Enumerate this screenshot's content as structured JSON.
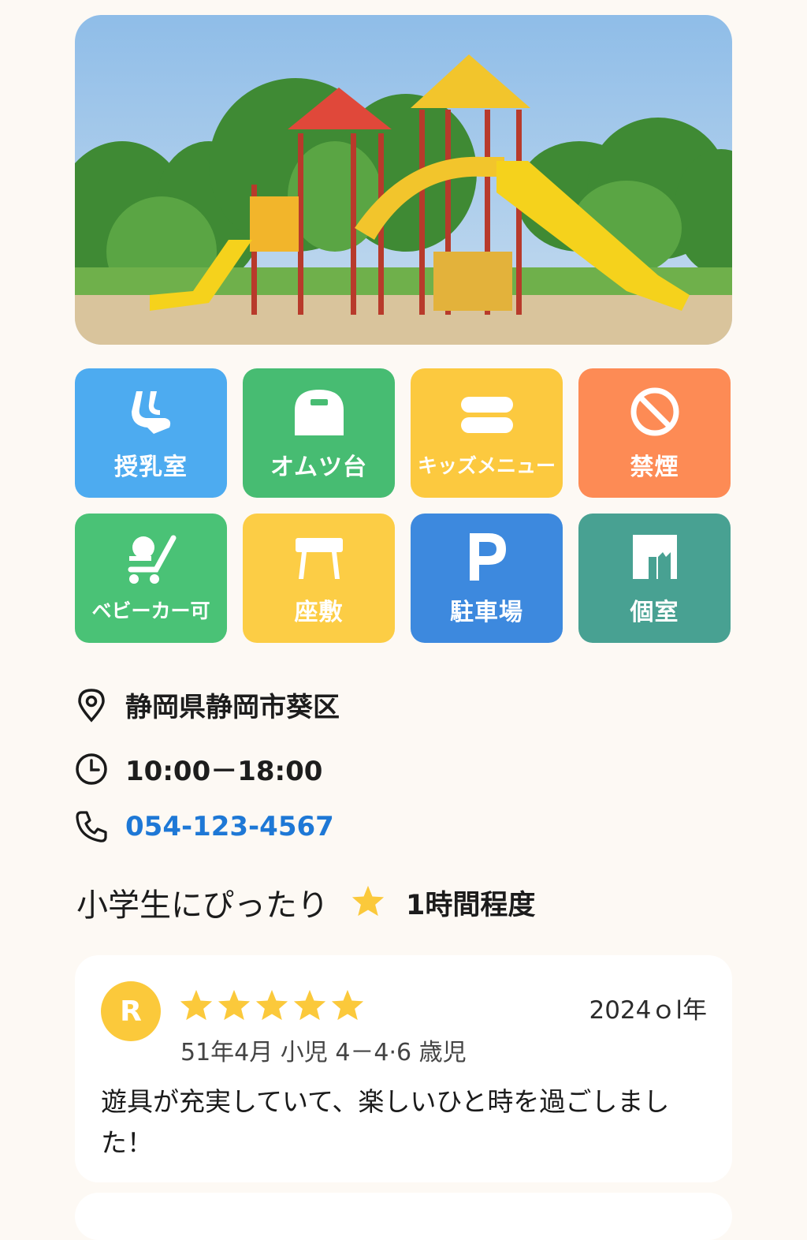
{
  "hero": {
    "image": "playground-photo"
  },
  "amenities": [
    {
      "label": "授乳室",
      "icon": "nursing-room-icon",
      "color": "#4dabf0"
    },
    {
      "label": "オムツ台",
      "icon": "diaper-table-icon",
      "color": "#47bc72"
    },
    {
      "label": "キッズメニュー",
      "icon": "kids-menu-icon",
      "color": "#fcc93f"
    },
    {
      "label": "禁煙",
      "icon": "no-smoking-icon",
      "color": "#fd8b55"
    },
    {
      "label": "ベビーカー可",
      "icon": "stroller-icon",
      "color": "#4ac276"
    },
    {
      "label": "座敷",
      "icon": "tatami-seat-icon",
      "color": "#fccd45"
    },
    {
      "label": "駐車場",
      "icon": "parking-icon",
      "color": "#3d89de"
    },
    {
      "label": "個室",
      "icon": "private-room-icon",
      "color": "#48a192"
    }
  ],
  "info": {
    "address": "静岡県静岡市葵区",
    "hours": "10:00－18:00",
    "phone": "054-123-4567"
  },
  "tagline": {
    "audience": "小学生にぴったり",
    "duration": "1時間程度"
  },
  "review": {
    "avatar_letter": "R",
    "rating": 5,
    "date": "2024ｏl年",
    "meta": "51年4月  小児   4－4·6 歳児",
    "body": "遊具が充実していて、楽しいひと時を過ごしました！"
  },
  "colors": {
    "accent": "#1e78d6",
    "star": "#fbc93b"
  }
}
